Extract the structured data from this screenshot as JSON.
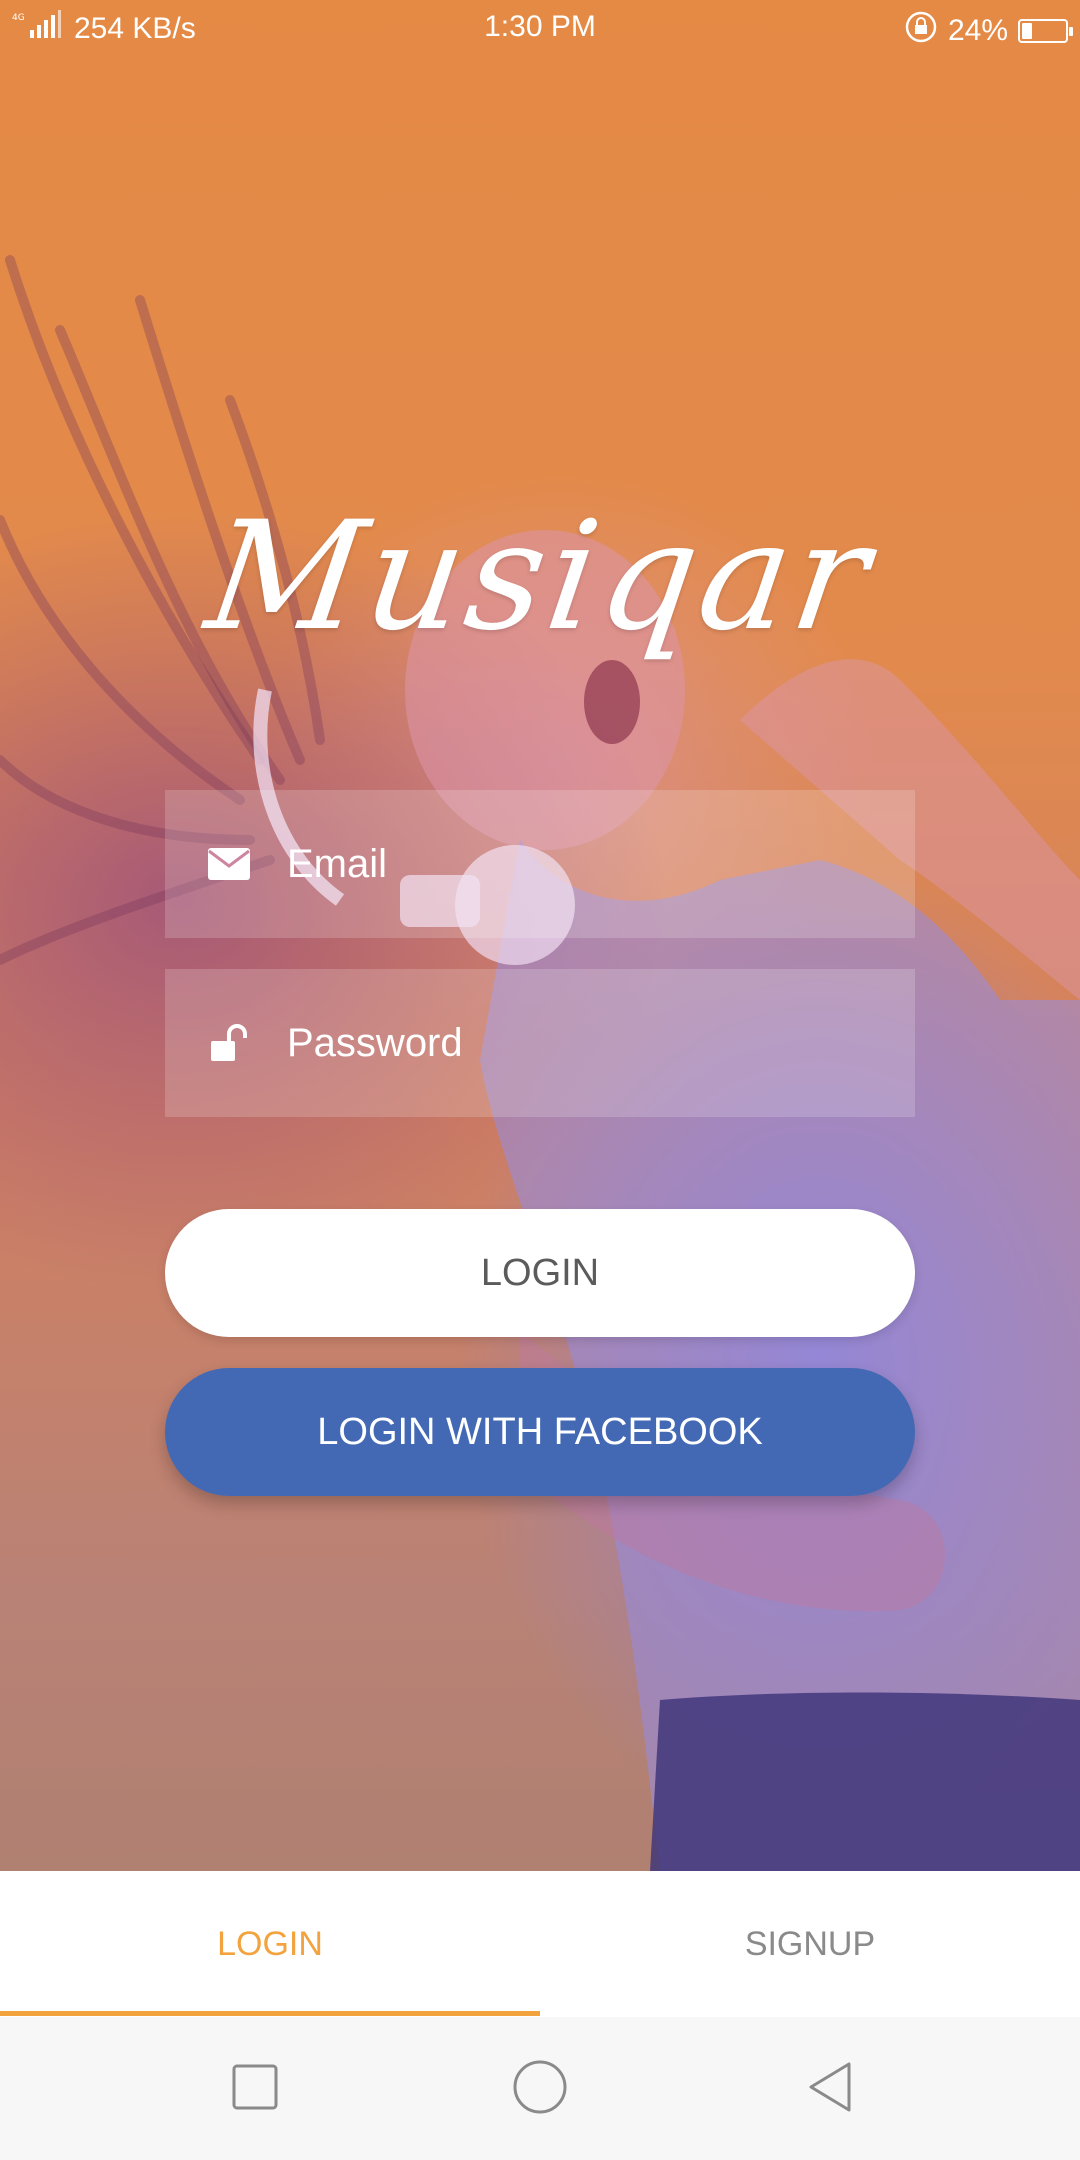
{
  "status_bar": {
    "net_speed": "254 KB/s",
    "time": "1:30 PM",
    "battery": "24%",
    "battery_level": 0.24,
    "icons": [
      "signal-icon",
      "rotation-lock-icon",
      "battery-icon"
    ]
  },
  "app": {
    "logo_text": "Musiqar"
  },
  "form": {
    "email_placeholder": "Email",
    "password_placeholder": "Password",
    "email_icon": "envelope-icon",
    "password_icon": "unlock-icon"
  },
  "buttons": {
    "login": "LOGIN",
    "facebook": "LOGIN WITH FACEBOOK"
  },
  "tabs": {
    "login": "LOGIN",
    "signup": "SIGNUP",
    "active": "login"
  },
  "colors": {
    "accent": "#f3a33e",
    "facebook": "#4469b4",
    "background": "#e58b45"
  },
  "navbar": {
    "icons": [
      "recents-square-icon",
      "home-circle-icon",
      "back-triangle-icon"
    ]
  }
}
